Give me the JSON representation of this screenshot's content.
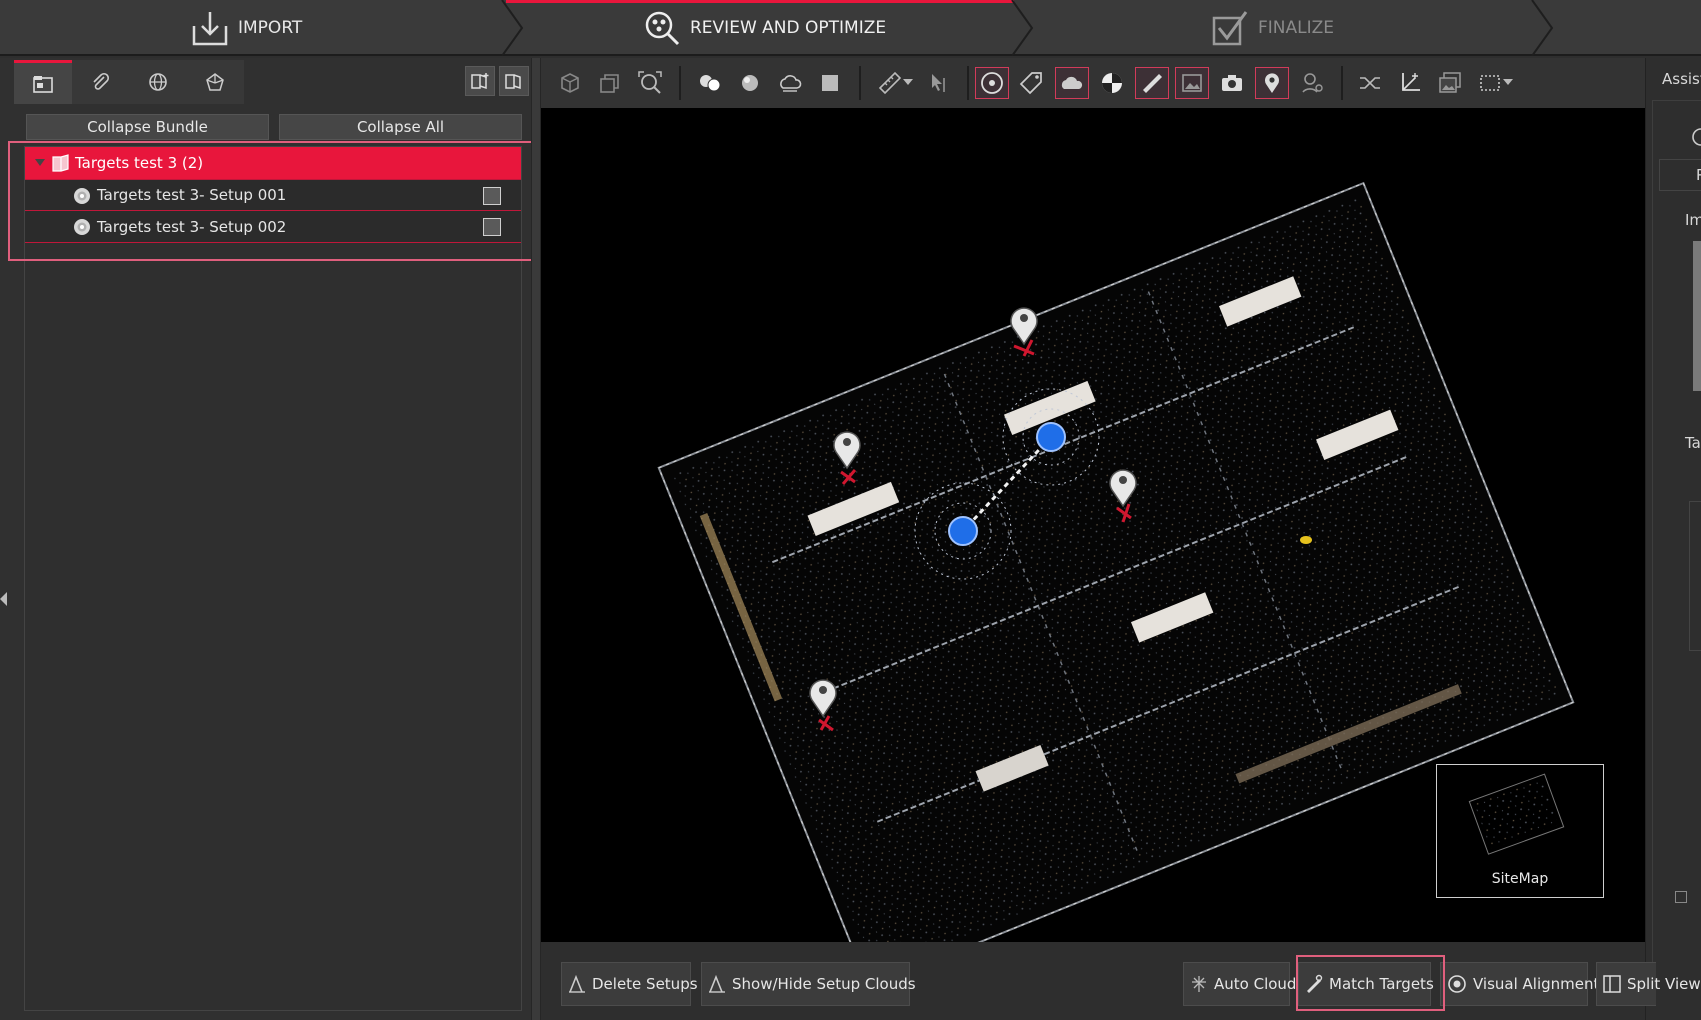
{
  "workflow": {
    "steps": [
      {
        "label": "IMPORT",
        "icon": "import-icon",
        "state": "done"
      },
      {
        "label": "REVIEW AND OPTIMIZE",
        "icon": "review-magnifier-icon",
        "state": "active"
      },
      {
        "label": "FINALIZE",
        "icon": "finalize-check-icon",
        "state": "inactive"
      }
    ],
    "accent": "#e8163c"
  },
  "left_panel": {
    "collapse_bundle": "Collapse Bundle",
    "collapse_all": "Collapse All",
    "tree": {
      "bundle": {
        "label": "Targets test 3 (2)"
      },
      "setups": [
        {
          "label": "Targets test 3- Setup 001"
        },
        {
          "label": "Targets test 3- Setup 002"
        }
      ]
    }
  },
  "viewport": {
    "sitemap_label": "SiteMap"
  },
  "right_panel": {
    "header": "Assist",
    "label_p": "P",
    "label_ima": "Ima",
    "label_tar": "Tar"
  },
  "bottom_bar": {
    "delete_setups": "Delete Setups",
    "show_hide": "Show/Hide Setup Clouds",
    "auto_cloud": "Auto Cloud",
    "match_targets": "Match Targets",
    "visual_alignment": "Visual Alignment",
    "split_view": "Split View"
  }
}
